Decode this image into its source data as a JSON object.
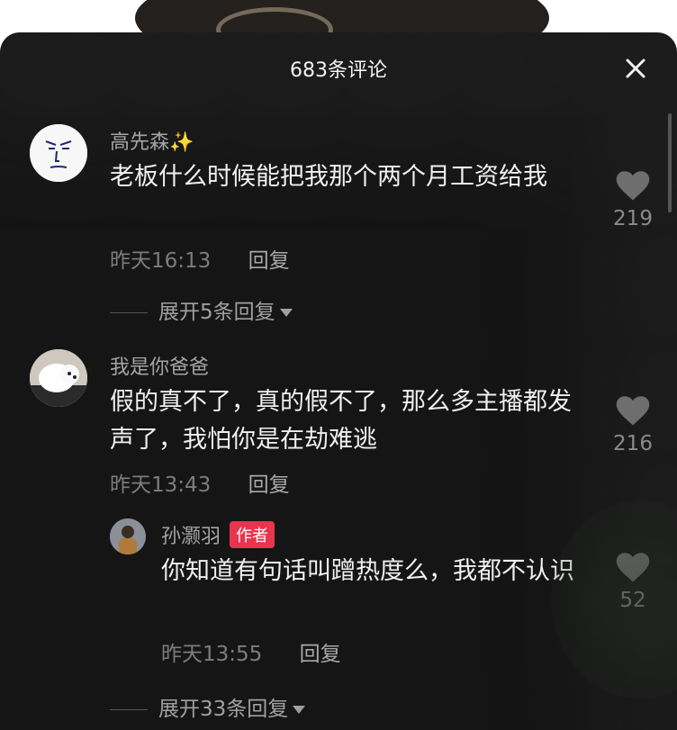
{
  "header": {
    "title": "683条评论",
    "close_icon": "close-icon"
  },
  "comments": [
    {
      "username": "高先森✨",
      "text": "老板什么时候能把我那个两个月工资给我",
      "time": "昨天16:13",
      "reply_label": "回复",
      "likes": "219",
      "expand_label": "展开5条回复"
    },
    {
      "username": "我是你爸爸",
      "text": "假的真不了，真的假不了，那么多主播都发声了，我怕你是在劫难逃",
      "time": "昨天13:43",
      "reply_label": "回复",
      "likes": "216",
      "replies": [
        {
          "username": "孙灏羽",
          "badge": "作者",
          "text": "你知道有句话叫蹭热度么，我都不认识",
          "time": "昨天13:55",
          "reply_label": "回复",
          "likes": "52"
        }
      ],
      "expand_label": "展开33条回复"
    }
  ],
  "icons": {
    "like": "heart-icon",
    "expand": "caret-down-icon"
  },
  "colors": {
    "sheet_bg": "#151515",
    "author_badge": "#e8344e"
  }
}
